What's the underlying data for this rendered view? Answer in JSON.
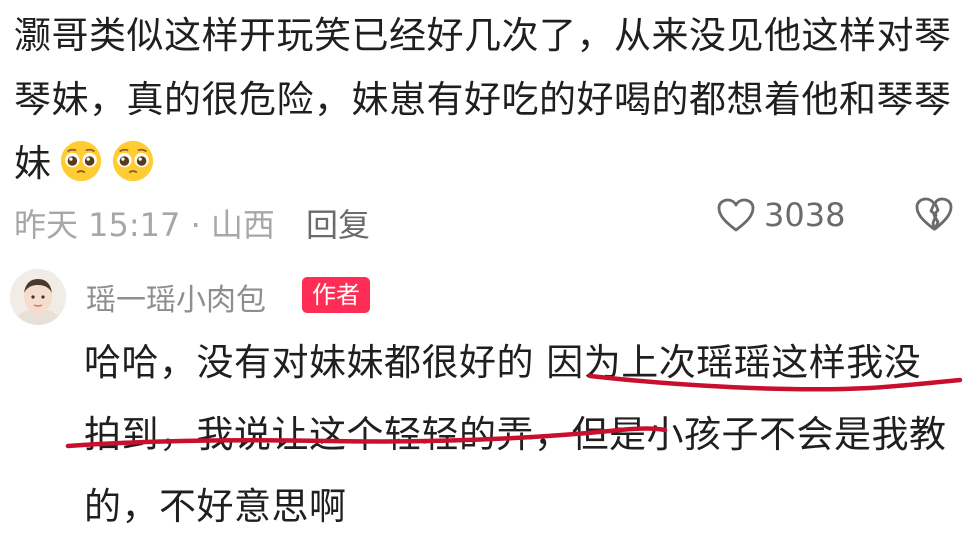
{
  "comment": {
    "text": "灏哥类似这样开玩笑已经好几次了，从来没见他这样对琴琴妹，真的很危险，妹崽有好吃的好喝的都想着他和琴琴妹",
    "emojis": [
      "pleading-face-icon",
      "pleading-face-icon"
    ],
    "time_location": "昨天 15:17 · 山西",
    "reply_label": "回复",
    "likes": "3038"
  },
  "reply": {
    "author": "瑶一瑶小肉包",
    "badge": "作者",
    "text": "哈哈，没有对妹妹都很好的 因为上次瑶瑶这样我没拍到，我说让这个轻轻的弄，但是小孩子不会是我教的，不好意思啊"
  },
  "colors": {
    "badge": "#ff2d55",
    "annotation": "#c8102e",
    "text": "#1f1f1f",
    "muted": "#a7a7a7"
  }
}
